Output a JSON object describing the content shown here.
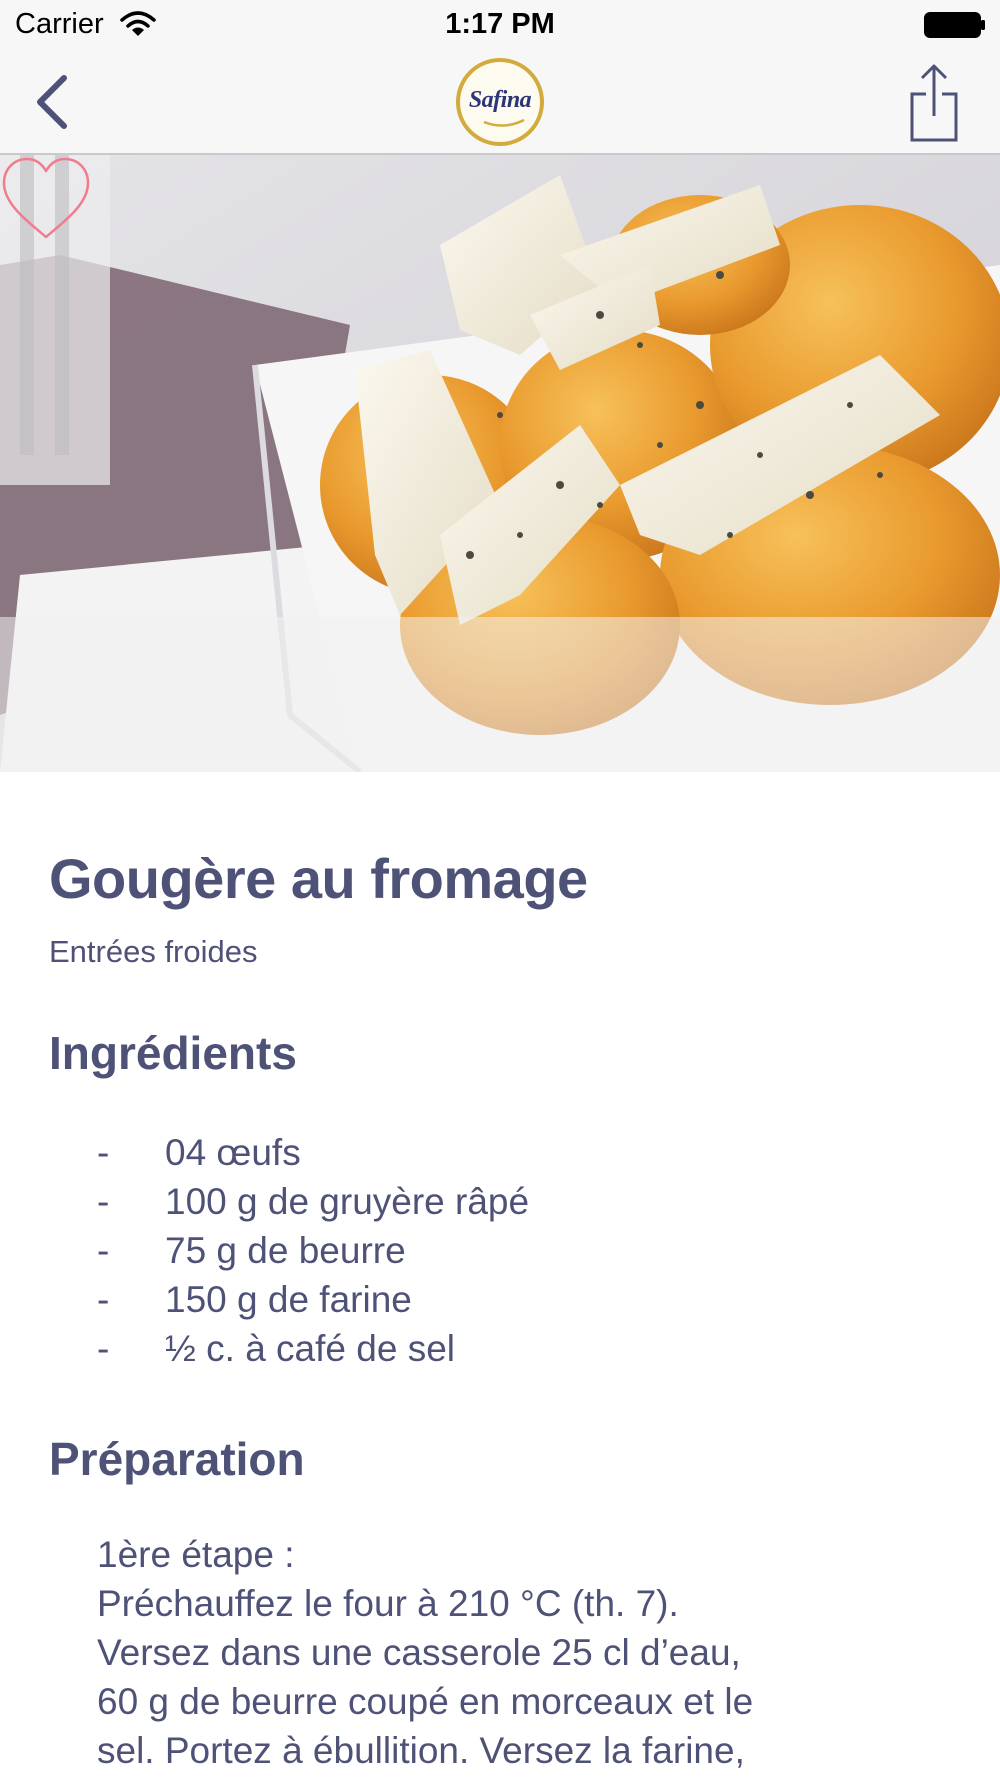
{
  "status_bar": {
    "carrier": "Carrier",
    "time": "1:17 PM",
    "icons": [
      "wifi-icon",
      "battery-icon"
    ]
  },
  "nav": {
    "back_icon": "chevron-left-icon",
    "logo_text": "Safina",
    "share_icon": "share-icon"
  },
  "hero": {
    "favorite_icon": "heart-outline-icon",
    "favorite_color": "#f07c8e"
  },
  "recipe": {
    "title": "Gougère au fromage",
    "category": "Entrées froides",
    "ingredients_heading": "Ingrédients",
    "ingredients": [
      {
        "dash": "-",
        "text": "04 œufs"
      },
      {
        "dash": "-",
        "text": "100 g de gruyère râpé"
      },
      {
        "dash": "-",
        "text": "75 g de beurre"
      },
      {
        "dash": "-",
        "text": "150 g de farine"
      },
      {
        "dash": "-",
        "text": "½ c. à café de sel"
      }
    ],
    "preparation_heading": "Préparation",
    "preparation_lines": [
      "1ère étape :",
      "Préchauffez le four à 210 °C (th. 7).",
      "Versez dans une casserole 25 cl d’eau,",
      "60 g de beurre coupé en morceaux et le",
      "sel. Portez à ébullition. Versez la farine,"
    ]
  },
  "colors": {
    "text": "#4e5277",
    "nav_background": "#f7f7f7",
    "logo_ring": "#d2ab3c",
    "logo_text": "#2d3478"
  }
}
